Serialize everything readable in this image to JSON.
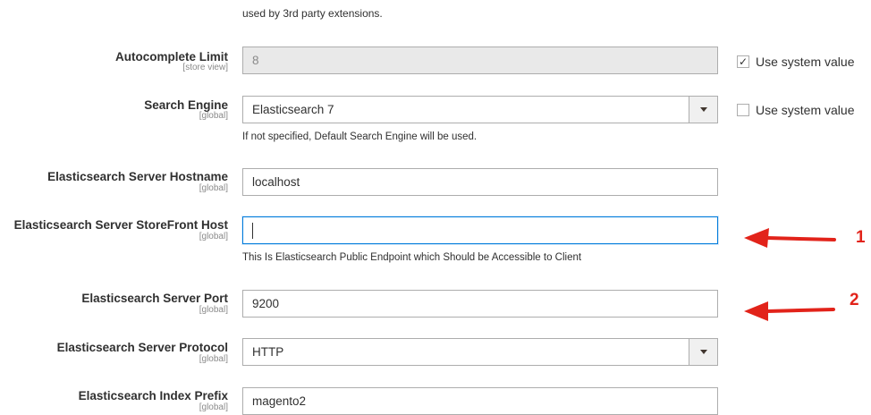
{
  "top_note": "used by 3rd party extensions.",
  "fields": {
    "autocomplete_limit": {
      "label": "Autocomplete Limit",
      "scope": "[store view]",
      "value": "8",
      "use_system_label": "Use system value",
      "use_system_checked": true
    },
    "search_engine": {
      "label": "Search Engine",
      "scope": "[global]",
      "value": "Elasticsearch 7",
      "note": "If not specified, Default Search Engine will be used.",
      "use_system_label": "Use system value",
      "use_system_checked": false
    },
    "es_hostname": {
      "label": "Elasticsearch Server Hostname",
      "scope": "[global]",
      "value": "localhost"
    },
    "es_storefront_host": {
      "label": "Elasticsearch Server StoreFront Host",
      "scope": "[global]",
      "value": "",
      "note": "This Is Elasticsearch Public Endpoint which Should be Accessible to Client"
    },
    "es_port": {
      "label": "Elasticsearch Server Port",
      "scope": "[global]",
      "value": "9200"
    },
    "es_protocol": {
      "label": "Elasticsearch Server Protocol",
      "scope": "[global]",
      "value": "HTTP"
    },
    "es_index_prefix": {
      "label": "Elasticsearch Index Prefix",
      "scope": "[global]",
      "value": "magento2"
    }
  },
  "annotations": {
    "marker_1": "1",
    "marker_2": "2",
    "arrow_color": "#e2231a"
  },
  "colors": {
    "focus_border": "#007bdb",
    "disabled_bg": "#e9e9e9"
  }
}
